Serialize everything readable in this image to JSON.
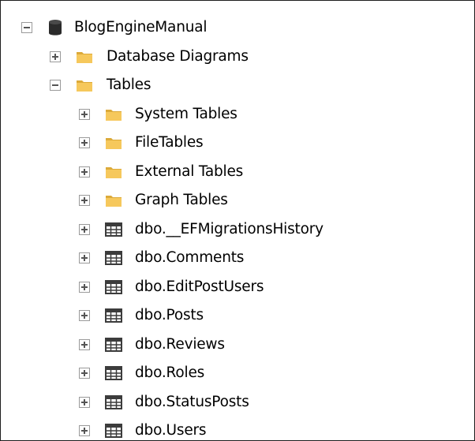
{
  "tree": {
    "database": {
      "label": "BlogEngineManual",
      "expanded": true,
      "icon": "database-icon"
    },
    "folders": [
      {
        "label": "Database Diagrams",
        "expanded": false,
        "icon": "folder-icon"
      },
      {
        "label": "Tables",
        "expanded": true,
        "icon": "folder-icon"
      }
    ],
    "table_folders": [
      {
        "label": "System Tables",
        "icon": "folder-icon"
      },
      {
        "label": "FileTables",
        "icon": "folder-icon"
      },
      {
        "label": "External Tables",
        "icon": "folder-icon"
      },
      {
        "label": "Graph Tables",
        "icon": "folder-icon"
      }
    ],
    "tables": [
      {
        "label": "dbo.__EFMigrationsHistory",
        "icon": "table-icon"
      },
      {
        "label": "dbo.Comments",
        "icon": "table-icon"
      },
      {
        "label": "dbo.EditPostUsers",
        "icon": "table-icon"
      },
      {
        "label": "dbo.Posts",
        "icon": "table-icon"
      },
      {
        "label": "dbo.Reviews",
        "icon": "table-icon"
      },
      {
        "label": "dbo.Roles",
        "icon": "table-icon"
      },
      {
        "label": "dbo.StatusPosts",
        "icon": "table-icon"
      },
      {
        "label": "dbo.Users",
        "icon": "table-icon"
      }
    ]
  },
  "colors": {
    "folder": "#f6c85c",
    "folder_dark": "#dcaa3a",
    "database": "#2b2b2b",
    "table_grid": "#3c3c3c",
    "border": "#1e1e1e"
  }
}
